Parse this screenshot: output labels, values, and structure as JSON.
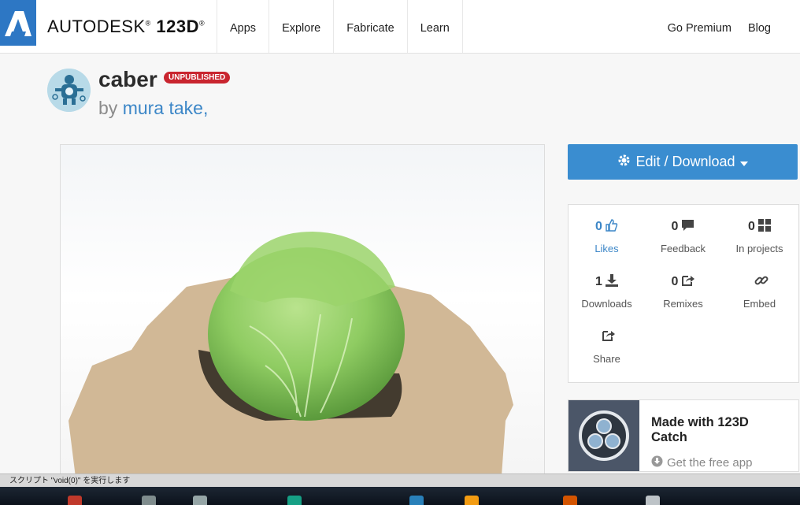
{
  "header": {
    "brand_name": "AUTODESK",
    "brand_product": "123D",
    "nav": [
      "Apps",
      "Explore",
      "Fabricate",
      "Learn"
    ],
    "right_nav": [
      "Go Premium",
      "Blog"
    ]
  },
  "model": {
    "title": "caber",
    "badge": "UNPUBLISHED",
    "by": "by",
    "author": "mura take",
    "author_suffix": ","
  },
  "actions": {
    "edit_download": "Edit / Download"
  },
  "stats": [
    {
      "value": "0",
      "label": "Likes",
      "icon": "thumbs-up-icon"
    },
    {
      "value": "0",
      "label": "Feedback",
      "icon": "comment-icon"
    },
    {
      "value": "0",
      "label": "In projects",
      "icon": "grid-icon"
    },
    {
      "value": "1",
      "label": "Downloads",
      "icon": "download-icon"
    },
    {
      "value": "0",
      "label": "Remixes",
      "icon": "remix-icon"
    },
    {
      "value": "",
      "label": "Embed",
      "icon": "link-icon"
    },
    {
      "value": "",
      "label": "Share",
      "icon": "share-icon"
    }
  ],
  "promo": {
    "title": "Made with 123D Catch",
    "subtitle": "Get the free app"
  },
  "status_text": "スクリプト \"void(0)\" を実行します",
  "colors": {
    "accent": "#3a8dd0",
    "badge": "#c9252f",
    "link": "#3b86c7"
  }
}
